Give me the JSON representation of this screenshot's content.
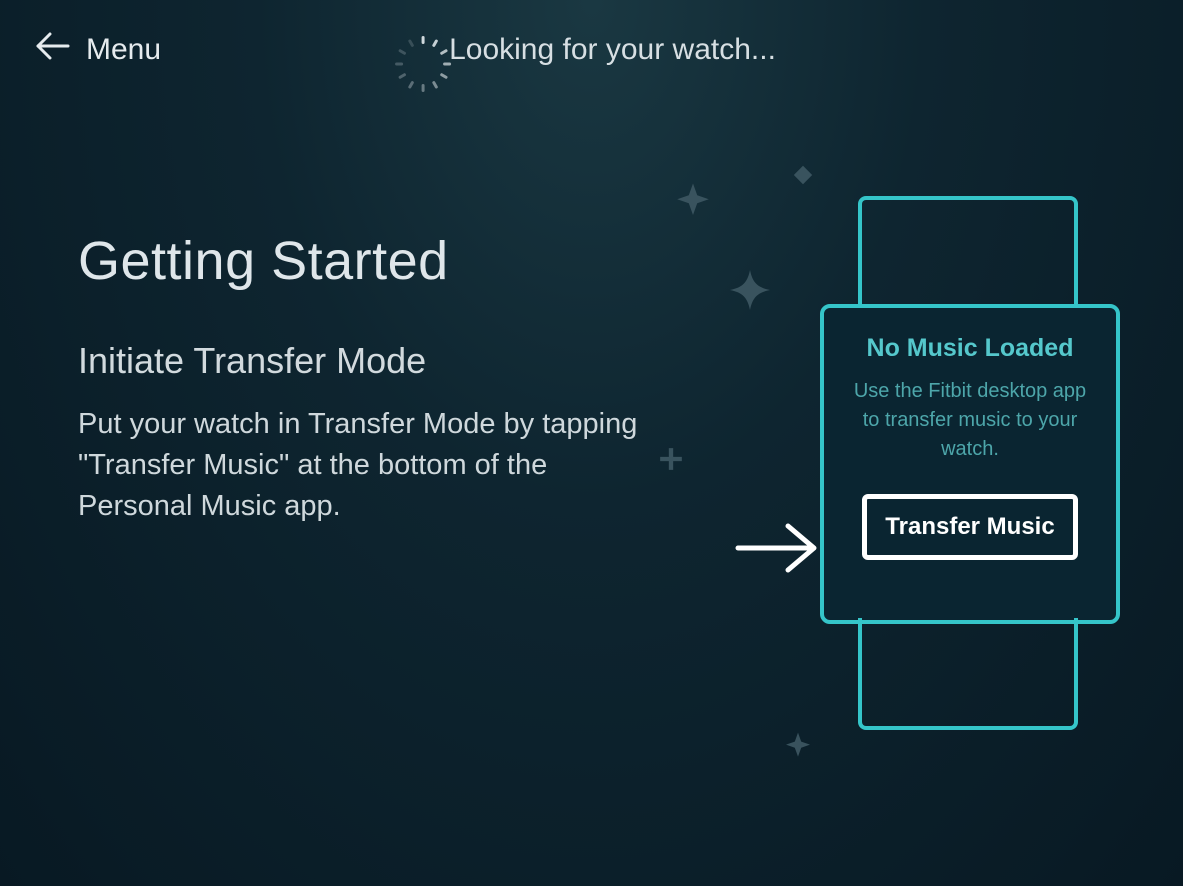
{
  "header": {
    "menu_label": "Menu",
    "status_text": "Looking for your watch..."
  },
  "main": {
    "title": "Getting Started",
    "subtitle": "Initiate Transfer Mode",
    "body": "Put your watch in Transfer Mode by tapping \"Transfer Music\" at the bottom of the Personal Music app."
  },
  "watch": {
    "title": "No Music Loaded",
    "description": "Use the Fitbit desktop app to transfer music to your watch.",
    "button_label": "Transfer Music"
  },
  "colors": {
    "accent": "#35c5c9",
    "text": "#d7dfe3"
  }
}
